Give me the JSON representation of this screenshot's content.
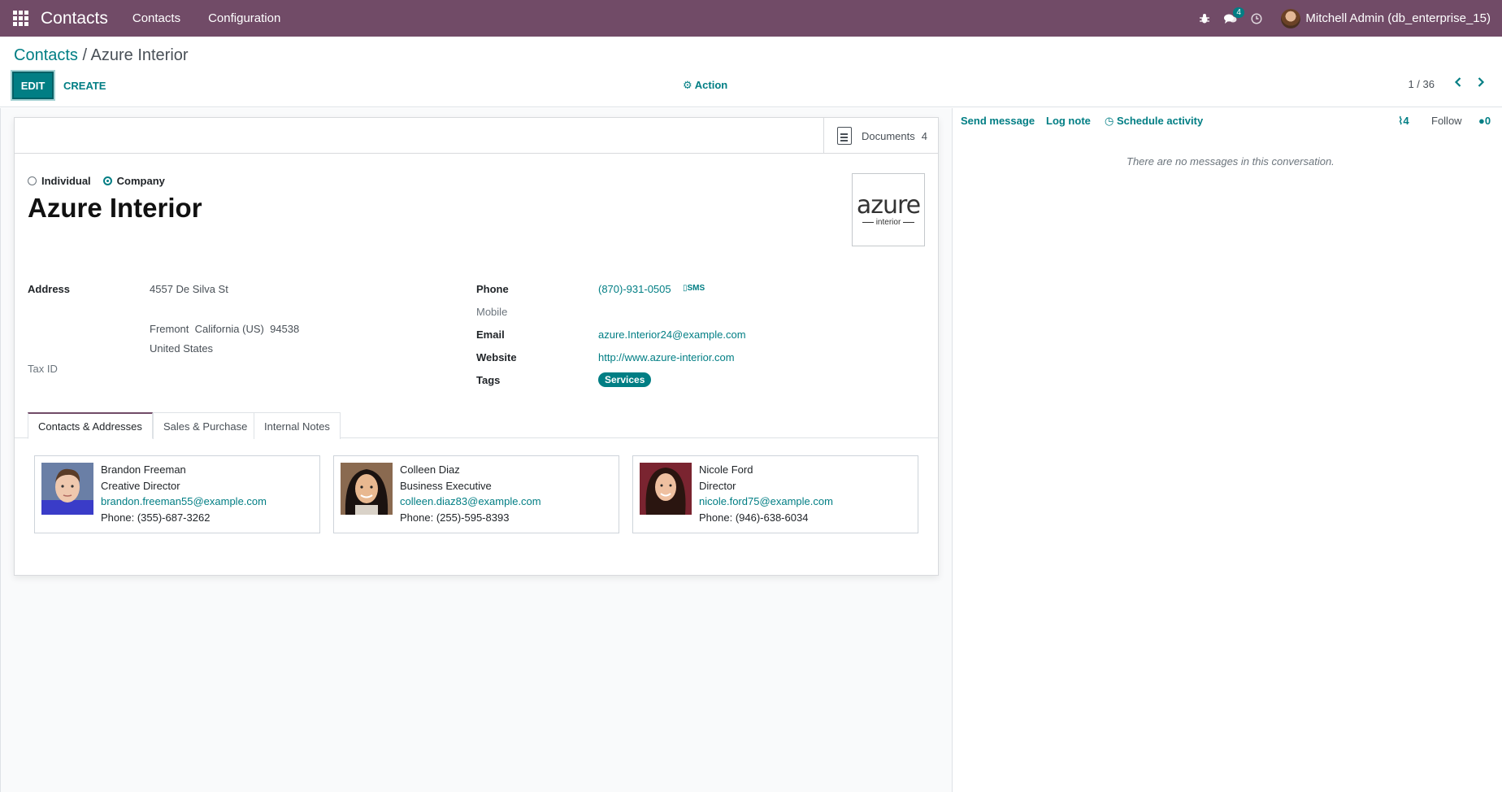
{
  "navbar": {
    "app_name": "Contacts",
    "menus": [
      "Contacts",
      "Configuration"
    ],
    "messages_badge": "4",
    "user": "Mitchell Admin (db_enterprise_15)"
  },
  "breadcrumb": {
    "parent": "Contacts",
    "separator": "/",
    "current": "Azure Interior"
  },
  "toolbar": {
    "edit": "EDIT",
    "create": "CREATE",
    "action": "Action",
    "pager": "1 / 36"
  },
  "smart_buttons": {
    "documents_label": "Documents",
    "documents_count": "4"
  },
  "partner": {
    "type_options": [
      "Individual",
      "Company"
    ],
    "selected_type": "Company",
    "name": "Azure Interior",
    "logo_main": "azure",
    "logo_sub": "interior"
  },
  "fields": {
    "address_label": "Address",
    "street": "4557 De Silva St",
    "city_line": "Fremont  California (US)  94538",
    "country": "United States",
    "tax_label": "Tax ID",
    "phone_label": "Phone",
    "phone": "(870)-931-0505",
    "sms": "SMS",
    "mobile_label": "Mobile",
    "email_label": "Email",
    "email": "azure.Interior24@example.com",
    "website_label": "Website",
    "website": "http://www.azure-interior.com",
    "tags_label": "Tags",
    "tag": "Services"
  },
  "tabs": [
    "Contacts & Addresses",
    "Sales & Purchase",
    "Internal Notes"
  ],
  "contacts": [
    {
      "name": "Brandon Freeman",
      "title": "Creative Director",
      "email": "brandon.freeman55@example.com",
      "phone": "Phone: (355)-687-3262"
    },
    {
      "name": "Colleen Diaz",
      "title": "Business Executive",
      "email": "colleen.diaz83@example.com",
      "phone": "Phone: (255)-595-8393"
    },
    {
      "name": "Nicole Ford",
      "title": "Director",
      "email": "nicole.ford75@example.com",
      "phone": "Phone: (946)-638-6034"
    }
  ],
  "chatter": {
    "send_message": "Send message",
    "log_note": "Log note",
    "schedule_activity": "Schedule activity",
    "attachments_count": "4",
    "follow": "Follow",
    "followers_count": "0",
    "empty_text": "There are no messages in this conversation."
  },
  "colors": {
    "brand": "#714B67",
    "accent": "#017e84"
  }
}
